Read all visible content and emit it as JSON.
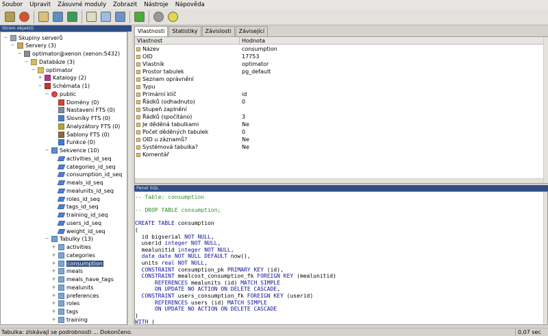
{
  "menu": [
    "Soubor",
    "Upravit",
    "Zásuvné moduly",
    "Zobrazit",
    "Nástroje",
    "Nápověda"
  ],
  "toolbar_icons": [
    "connect-icon",
    "refresh-icon",
    "folder-icon",
    "properties-icon",
    "delete-icon",
    "sql-icon",
    "grid-icon",
    "table-edit-icon",
    "plugin-icon",
    "hint-icon",
    "help-icon"
  ],
  "browser": {
    "title": "Strom objektů"
  },
  "tree": [
    {
      "label": "Skupiny serverů",
      "icon": "server-group-icon"
    },
    {
      "label": "Servery (3)",
      "icon": "servers-icon"
    },
    {
      "label": "optimator@xenon (xenon:5432)",
      "icon": "server-icon"
    },
    {
      "label": "Databáze (3)",
      "icon": "databases-icon"
    },
    {
      "label": "optimator",
      "icon": "database-icon"
    },
    {
      "label": "Katalogy (2)",
      "icon": "catalog-icon"
    },
    {
      "label": "Schémata (1)",
      "icon": "schemas-icon"
    },
    {
      "label": "public",
      "icon": "schema-icon"
    },
    {
      "label": "Domény (0)",
      "icon": "domain-icon"
    },
    {
      "label": "Nastavení FTS (0)",
      "icon": "fts-config-icon"
    },
    {
      "label": "Slovníky FTS (0)",
      "icon": "fts-dict-icon"
    },
    {
      "label": "Analyzátory FTS (0)",
      "icon": "fts-parser-icon"
    },
    {
      "label": "Šablony FTS (0)",
      "icon": "fts-template-icon"
    },
    {
      "label": "Funkce (0)",
      "icon": "function-icon"
    },
    {
      "label": "Sekvence (10)",
      "icon": "sequences-icon"
    },
    {
      "label": "activities_id_seq",
      "icon": "sequence-icon"
    },
    {
      "label": "categories_id_seq",
      "icon": "sequence-icon"
    },
    {
      "label": "consumption_id_seq",
      "icon": "sequence-icon"
    },
    {
      "label": "meals_id_seq",
      "icon": "sequence-icon"
    },
    {
      "label": "mealunits_id_seq",
      "icon": "sequence-icon"
    },
    {
      "label": "roles_id_seq",
      "icon": "sequence-icon"
    },
    {
      "label": "tags_id_seq",
      "icon": "sequence-icon"
    },
    {
      "label": "training_id_seq",
      "icon": "sequence-icon"
    },
    {
      "label": "users_id_seq",
      "icon": "sequence-icon"
    },
    {
      "label": "weight_id_seq",
      "icon": "sequence-icon"
    },
    {
      "label": "Tabulky (13)",
      "icon": "tables-icon"
    },
    {
      "label": "activities",
      "icon": "table-icon"
    },
    {
      "label": "categories",
      "icon": "table-icon"
    },
    {
      "label": "consumption",
      "icon": "table-icon"
    },
    {
      "label": "meals",
      "icon": "table-icon"
    },
    {
      "label": "meals_have_tags",
      "icon": "table-icon"
    },
    {
      "label": "mealunits",
      "icon": "table-icon"
    },
    {
      "label": "preferences",
      "icon": "table-icon"
    },
    {
      "label": "roles",
      "icon": "table-icon"
    },
    {
      "label": "tags",
      "icon": "table-icon"
    },
    {
      "label": "training",
      "icon": "table-icon"
    }
  ],
  "tabs": [
    "Vlastnosti",
    "Statistiky",
    "Závislosti",
    "Závisející"
  ],
  "props": {
    "col_key": "Vlastnost",
    "col_val": "Hodnota",
    "rows": [
      [
        "Název",
        "consumption"
      ],
      [
        "OID",
        "17753"
      ],
      [
        "Vlastník",
        "optimator"
      ],
      [
        "Prostor tabulek",
        "pg_default"
      ],
      [
        "Seznam oprávnění",
        ""
      ],
      [
        "Typu",
        ""
      ],
      [
        "Primární klíč",
        "id"
      ],
      [
        "Řádků (odhadnuto)",
        "0"
      ],
      [
        "Stupeň zaplnění",
        ""
      ],
      [
        "Řádků (spočítáno)",
        "3"
      ],
      [
        "Je děděná tabulkami",
        "Ne"
      ],
      [
        "Počet děděných tabulek",
        "0"
      ],
      [
        "OID u záznamů?",
        "Ne"
      ],
      [
        "Systémová tabulka?",
        "Ne"
      ],
      [
        "Komentář",
        ""
      ]
    ]
  },
  "sql_panel": {
    "title": "Panel SQL",
    "lines": [
      "-- Table: consumption",
      "",
      "-- DROP TABLE consumption;",
      "",
      "CREATE TABLE consumption",
      "(",
      "  id bigserial NOT NULL,",
      "  userid integer NOT NULL,",
      "  mealunitid integer NOT NULL,",
      "  date date NOT NULL DEFAULT now(),",
      "  units real NOT NULL,",
      "  CONSTRAINT consumption_pk PRIMARY KEY (id),",
      "  CONSTRAINT mealcost_consumption_fk FOREIGN KEY (mealunitid)",
      "      REFERENCES mealunits (id) MATCH SIMPLE",
      "      ON UPDATE NO ACTION ON DELETE CASCADE,",
      "  CONSTRAINT users_consumption_fk FOREIGN KEY (userid)",
      "      REFERENCES users (id) MATCH SIMPLE",
      "      ON UPDATE NO ACTION ON DELETE CASCADE",
      ")",
      "WITH ("
    ]
  },
  "status": {
    "message": "Tabulka: získávají se podrobnosti ... Dokončeno.",
    "time": "0,07 sec"
  }
}
